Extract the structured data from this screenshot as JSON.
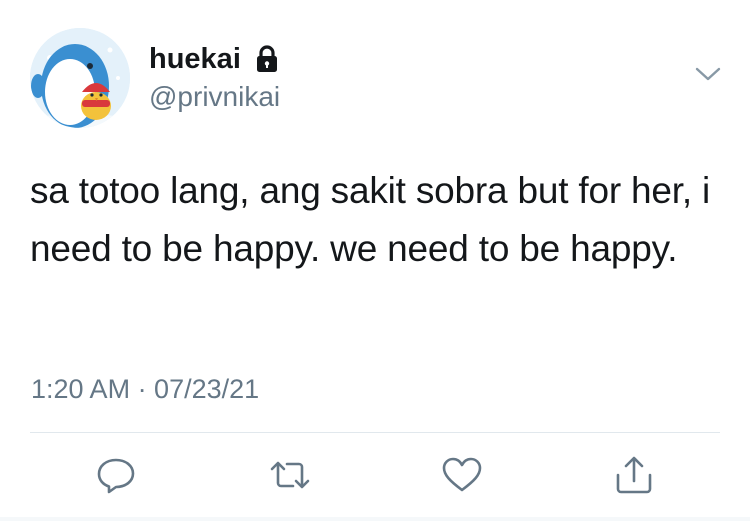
{
  "user": {
    "display_name": "huekai",
    "handle": "@privnikai",
    "protected": true,
    "avatar_icon": "penguin-with-chick-avatar"
  },
  "tweet": {
    "text": "sa totoo lang, ang sakit sobra but for her, i need to be happy. we need to be happy.",
    "timestamp": "1:20 AM · 07/23/21"
  },
  "actions": [
    {
      "icon": "reply-icon"
    },
    {
      "icon": "retweet-icon"
    },
    {
      "icon": "like-icon"
    },
    {
      "icon": "share-icon"
    }
  ],
  "colors": {
    "primary_text": "#14171a",
    "secondary_text": "#657786",
    "divider": "#e1e8ed"
  }
}
